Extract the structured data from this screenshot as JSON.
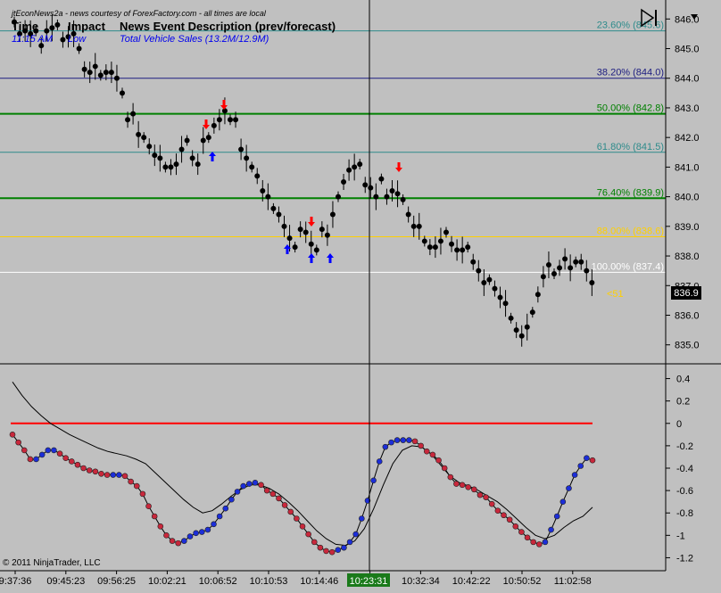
{
  "header": {
    "note": "jtEconNews2a - news courtesy of ForexFactory.com - all times are local",
    "col_time": "Time",
    "col_impact": "Impact",
    "col_event": "News Event Description (prev/forecast)",
    "time": "11:15 AM",
    "impact": "Low",
    "event": "Total Vehicle Sales (13.2M/12.9M)"
  },
  "copyright": "© 2011 NinjaTrader, LLC",
  "icons": {
    "nav": "skip-to-end-icon"
  },
  "colors": {
    "background": "#c0c0c0",
    "fib_teal": "#2e8b8b",
    "fib_navy": "#1c1c80",
    "fib_green": "#008000",
    "fib_yellow": "#ffd000",
    "fib_white": "#ffffff",
    "osc_line": "#ff0000",
    "dot_up": "#1c2ed8",
    "dot_down": "#c8283c",
    "arrow_up": "#0000ff",
    "arrow_down": "#ff0000",
    "crosshair_label_bg": "#1a7a1a",
    "count_label": "#ffd000"
  },
  "chart_data": {
    "type": "line",
    "price_axis": {
      "ylim": [
        834.6,
        846.4
      ],
      "ticks": [
        "846.0",
        "845.0",
        "844.0",
        "843.0",
        "842.0",
        "841.0",
        "840.0",
        "839.0",
        "838.0",
        "837.0",
        "836.0",
        "835.0"
      ]
    },
    "osc_axis": {
      "ylim": [
        -1.3,
        0.5
      ],
      "ticks": [
        "0.4",
        "0.2",
        "0",
        "-0.2",
        "-0.4",
        "-0.6",
        "-0.8",
        "-1",
        "-1.2"
      ]
    },
    "time_ticks": [
      "9:37:36",
      "09:45:23",
      "09:56:25",
      "10:02:21",
      "10:06:52",
      "10:10:53",
      "10:14:46",
      "10:18:",
      "10:32:34",
      "10:42:22",
      "10:50:52",
      "11:02:58"
    ],
    "fib_levels": [
      {
        "label": "23.60% (845.6)",
        "price": 845.6,
        "color": "fib_teal"
      },
      {
        "label": "38.20% (844.0)",
        "price": 844.0,
        "color": "fib_navy"
      },
      {
        "label": "50.00% (842.8)",
        "price": 842.8,
        "color": "fib_green"
      },
      {
        "label": "61.80% (841.5)",
        "price": 841.5,
        "color": "fib_teal"
      },
      {
        "label": "76.40% (839.9)",
        "price": 839.95,
        "color": "fib_green"
      },
      {
        "label": "88.00% (838.6)",
        "price": 838.65,
        "color": "fib_yellow"
      },
      {
        "label": "100.00% (837.4)",
        "price": 837.45,
        "color": "fib_white"
      }
    ],
    "last_price": "836.9",
    "bars_remaining": "<51",
    "crosshair_time": "10:23:31",
    "close": [
      845.9,
      845.5,
      845.6,
      845.5,
      845.6,
      845.1,
      845.6,
      845.7,
      845.8,
      845.3,
      845.4,
      845.5,
      845.0,
      844.3,
      844.2,
      844.4,
      844.1,
      844.2,
      844.2,
      844.0,
      843.5,
      842.6,
      842.8,
      842.1,
      842.0,
      841.7,
      841.4,
      841.3,
      841.0,
      841.0,
      841.1,
      841.6,
      841.9,
      841.3,
      841.1,
      841.9,
      842.0,
      842.4,
      842.6,
      842.9,
      842.6,
      842.6,
      841.6,
      841.3,
      841.0,
      840.7,
      840.2,
      840.0,
      839.6,
      839.4,
      839.0,
      838.6,
      838.3,
      838.9,
      838.8,
      838.4,
      838.2,
      838.9,
      838.7,
      839.4,
      840.0,
      840.5,
      840.9,
      841.0,
      841.1,
      840.4,
      840.3,
      840.0,
      840.6,
      840.0,
      840.2,
      840.1,
      839.9,
      839.4,
      839.0,
      839.0,
      838.5,
      838.3,
      838.3,
      838.5,
      838.8,
      838.4,
      838.2,
      838.2,
      838.3,
      837.8,
      837.5,
      837.1,
      837.2,
      836.9,
      836.6,
      836.4,
      835.9,
      835.5,
      835.3,
      835.6,
      836.1,
      836.7,
      837.3,
      837.7,
      837.4,
      837.6,
      837.9,
      837.6,
      837.8,
      837.8,
      837.5,
      837.1
    ],
    "oscillator": [
      -0.1,
      -0.17,
      -0.24,
      -0.32,
      -0.32,
      -0.28,
      -0.24,
      -0.24,
      -0.27,
      -0.31,
      -0.34,
      -0.37,
      -0.4,
      -0.42,
      -0.43,
      -0.45,
      -0.46,
      -0.46,
      -0.46,
      -0.47,
      -0.52,
      -0.56,
      -0.63,
      -0.74,
      -0.83,
      -0.92,
      -1.0,
      -1.05,
      -1.07,
      -1.05,
      -1.01,
      -0.98,
      -0.97,
      -0.95,
      -0.9,
      -0.83,
      -0.76,
      -0.68,
      -0.61,
      -0.56,
      -0.54,
      -0.53,
      -0.55,
      -0.6,
      -0.63,
      -0.67,
      -0.73,
      -0.79,
      -0.85,
      -0.92,
      -0.99,
      -1.06,
      -1.11,
      -1.14,
      -1.15,
      -1.13,
      -1.11,
      -1.06,
      -0.99,
      -0.85,
      -0.69,
      -0.51,
      -0.34,
      -0.21,
      -0.17,
      -0.15,
      -0.15,
      -0.15,
      -0.16,
      -0.2,
      -0.25,
      -0.28,
      -0.33,
      -0.4,
      -0.48,
      -0.54,
      -0.55,
      -0.57,
      -0.59,
      -0.64,
      -0.66,
      -0.72,
      -0.78,
      -0.82,
      -0.86,
      -0.92,
      -0.97,
      -1.02,
      -1.06,
      -1.08,
      -1.06,
      -0.95,
      -0.83,
      -0.7,
      -0.58,
      -0.46,
      -0.38,
      -0.31,
      -0.33
    ],
    "osc_trigger": [
      0.37,
      0.25,
      0.15,
      0.07,
      0.0,
      -0.05,
      -0.1,
      -0.14,
      -0.18,
      -0.22,
      -0.25,
      -0.27,
      -0.29,
      -0.32,
      -0.36,
      -0.44,
      -0.52,
      -0.6,
      -0.68,
      -0.75,
      -0.8,
      -0.78,
      -0.72,
      -0.65,
      -0.59,
      -0.55,
      -0.55,
      -0.58,
      -0.63,
      -0.7,
      -0.78,
      -0.87,
      -0.96,
      -1.03,
      -1.08,
      -1.09,
      -1.05,
      -0.94,
      -0.76,
      -0.55,
      -0.36,
      -0.24,
      -0.2,
      -0.21,
      -0.27,
      -0.37,
      -0.47,
      -0.53,
      -0.56,
      -0.6,
      -0.65,
      -0.7,
      -0.77,
      -0.85,
      -0.93,
      -1.0,
      -1.03,
      -1.0,
      -0.93,
      -0.87,
      -0.83,
      -0.75
    ]
  }
}
